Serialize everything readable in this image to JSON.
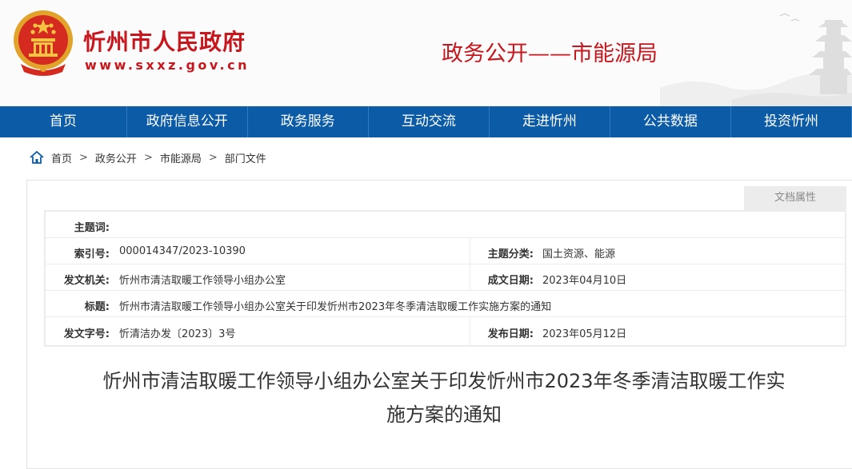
{
  "header": {
    "site_title": "忻州市人民政府",
    "site_url": "www.sxxz.gov.cn",
    "section_title": "政务公开——市能源局",
    "emblem_icon": "national-emblem-icon",
    "brand_color": "#c8161d"
  },
  "nav": {
    "background": "#0c5ba7",
    "items": [
      {
        "label": "首页"
      },
      {
        "label": "政府信息公开"
      },
      {
        "label": "政务服务"
      },
      {
        "label": "互动交流"
      },
      {
        "label": "走进忻州"
      },
      {
        "label": "公共数据"
      },
      {
        "label": "投资忻州"
      }
    ]
  },
  "breadcrumb": {
    "icon": "home-icon",
    "items": [
      "首页",
      "政务公开",
      "市能源局",
      "部门文件"
    ],
    "separator": ">"
  },
  "document": {
    "tab_label": "文档属性",
    "meta": {
      "keywords_label": "主题词:",
      "keywords_value": "",
      "index_label": "索引号:",
      "index_value": "000014347/2023-10390",
      "category_label": "主题分类:",
      "category_value": "国土资源、能源",
      "issuer_label": "发文机关:",
      "issuer_value": "忻州市清洁取暖工作领导小组办公室",
      "created_label": "成文日期:",
      "created_value": "2023年04月10日",
      "title_label": "标题:",
      "title_value": "忻州市清洁取暖工作领导小组办公室关于印发忻州市2023年冬季清洁取暖工作实施方案的通知",
      "docno_label": "发文字号:",
      "docno_value": "忻清洁办发〔2023〕3号",
      "published_label": "发布日期:",
      "published_value": "2023年05月12日"
    },
    "title_line1": "忻州市清洁取暖工作领导小组办公室关于印发忻州市2023年冬季清洁取暖工作实",
    "title_line2": "施方案的通知"
  }
}
